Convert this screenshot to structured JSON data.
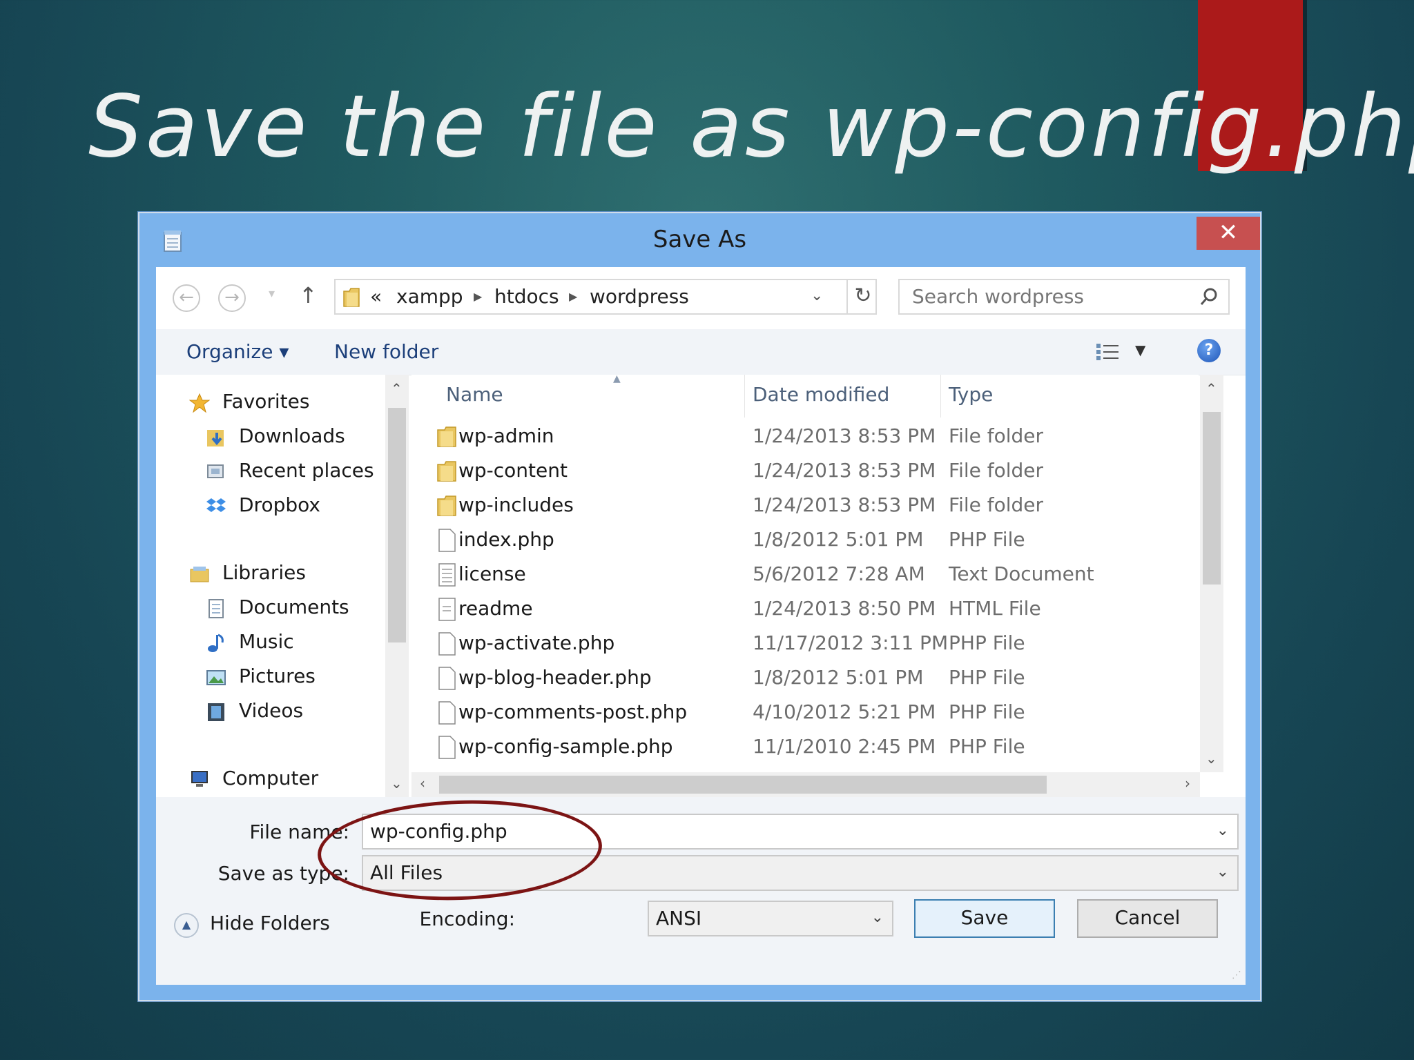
{
  "slide": {
    "title": "Save the file as wp-config.php"
  },
  "dialog": {
    "title": "Save As",
    "close_label": "✕",
    "nav": {
      "back_label": "←",
      "forward_label": "→",
      "up_label": "↑",
      "breadcrumb_overflow": "«",
      "breadcrumbs": [
        "xampp",
        "htdocs",
        "wordpress"
      ],
      "search_placeholder": "Search wordpress"
    },
    "toolbar": {
      "organize_label": "Organize ▾",
      "new_folder_label": "New folder",
      "help_label": "?"
    },
    "nav_pane": {
      "favorites": "Favorites",
      "downloads": "Downloads",
      "recent_places": "Recent places",
      "dropbox": "Dropbox",
      "libraries": "Libraries",
      "documents": "Documents",
      "music": "Music",
      "pictures": "Pictures",
      "videos": "Videos",
      "computer": "Computer"
    },
    "columns": {
      "name": "Name",
      "date_modified": "Date modified",
      "type": "Type"
    },
    "files": [
      {
        "name": "wp-admin",
        "date": "1/24/2013 8:53 PM",
        "type": "File folder",
        "icon": "folder-icon"
      },
      {
        "name": "wp-content",
        "date": "1/24/2013 8:53 PM",
        "type": "File folder",
        "icon": "folder-icon"
      },
      {
        "name": "wp-includes",
        "date": "1/24/2013 8:53 PM",
        "type": "File folder",
        "icon": "folder-icon"
      },
      {
        "name": "index.php",
        "date": "1/8/2012 5:01 PM",
        "type": "PHP File",
        "icon": "file-icon"
      },
      {
        "name": "license",
        "date": "5/6/2012 7:28 AM",
        "type": "Text Document",
        "icon": "text-file-icon"
      },
      {
        "name": "readme",
        "date": "1/24/2013 8:50 PM",
        "type": "HTML File",
        "icon": "html-file-icon"
      },
      {
        "name": "wp-activate.php",
        "date": "11/17/2012 3:11 PM",
        "type": "PHP File",
        "icon": "file-icon"
      },
      {
        "name": "wp-blog-header.php",
        "date": "1/8/2012 5:01 PM",
        "type": "PHP File",
        "icon": "file-icon"
      },
      {
        "name": "wp-comments-post.php",
        "date": "4/10/2012 5:21 PM",
        "type": "PHP File",
        "icon": "file-icon"
      },
      {
        "name": "wp-config-sample.php",
        "date": "11/1/2010 2:45 PM",
        "type": "PHP File",
        "icon": "file-icon"
      }
    ],
    "form": {
      "file_name_label": "File name:",
      "file_name_value": "wp-config.php",
      "save_as_type_label": "Save as type:",
      "save_as_type_value": "All Files",
      "encoding_label": "Encoding:",
      "encoding_value": "ANSI"
    },
    "buttons": {
      "hide_folders": "Hide Folders",
      "save": "Save",
      "cancel": "Cancel"
    }
  },
  "colors": {
    "accent_red": "#ab1a1a",
    "annotation_ellipse": "#7c1414",
    "window_frame": "#7bb3ec",
    "close_button": "#c75050"
  }
}
